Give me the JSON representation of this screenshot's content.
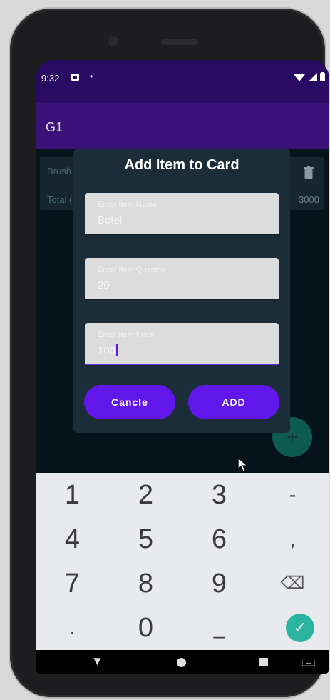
{
  "status_bar": {
    "time": "9:32",
    "notification_icon": "notification-icon",
    "dot": "•",
    "system_icons": "▾◢ ▮"
  },
  "app_bar": {
    "title": "G1"
  },
  "list": {
    "row_name": "Brush",
    "row_total_label": "Total (",
    "row_total_value": "3000"
  },
  "dialog": {
    "title": "Add Item to Card",
    "fields": [
      {
        "label": "Enter Item Name",
        "value": "Botel"
      },
      {
        "label": "Enter Item Quantity",
        "value": "20"
      },
      {
        "label": "Enter Item Price",
        "value": "100"
      }
    ],
    "cancel_label": "Cancle",
    "add_label": "ADD"
  },
  "fab": {
    "label": "+"
  },
  "keyboard": {
    "keys": [
      "1",
      "2",
      "3",
      "-",
      "4",
      "5",
      "6",
      ",",
      "7",
      "8",
      "9",
      "⌫",
      ".",
      "0",
      "_",
      "✓"
    ]
  },
  "nav": {
    "back": "▼",
    "home": "home-icon",
    "recents": "recents-icon"
  },
  "colors": {
    "status_bar": "#2a0b63",
    "app_bar": "#3a1178",
    "dialog_bg": "#1a2d38",
    "button": "#6217ea",
    "fab": "#0e5b52",
    "confirm_key": "#2bb5a0"
  }
}
